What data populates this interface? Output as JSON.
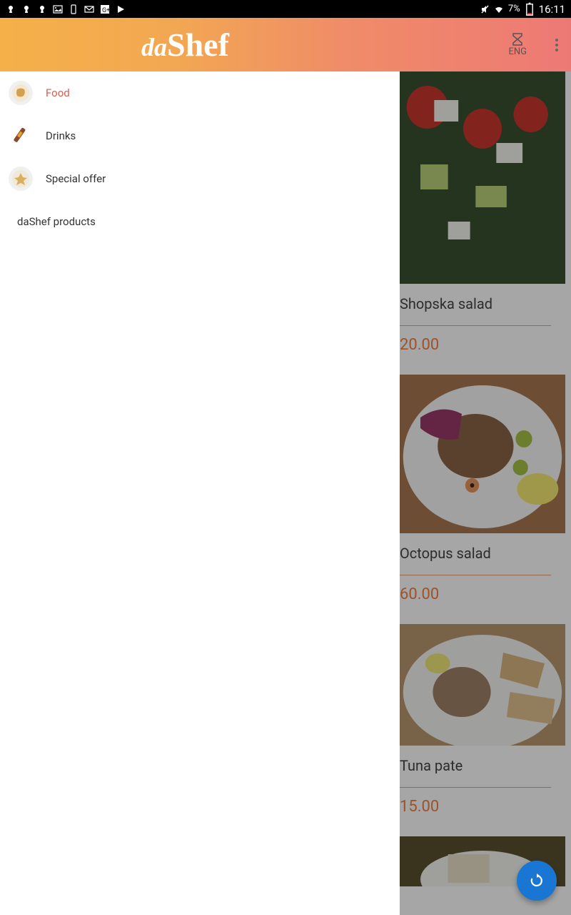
{
  "statusbar": {
    "battery": "7%",
    "time": "16:11"
  },
  "appbar": {
    "logo_da": "da",
    "logo_shef": "Shef",
    "lang": "ENG"
  },
  "drawer": {
    "items": [
      {
        "label": "Food",
        "active": true
      },
      {
        "label": "Drinks",
        "active": false
      },
      {
        "label": "Special offer",
        "active": false
      }
    ],
    "extra": "daShef products"
  },
  "menu": {
    "items": [
      {
        "name": "Shopska salad",
        "price": "20.00"
      },
      {
        "name": "Octopus salad",
        "price": "60.00"
      },
      {
        "name": "Tuna pate",
        "price": "15.00"
      }
    ]
  }
}
